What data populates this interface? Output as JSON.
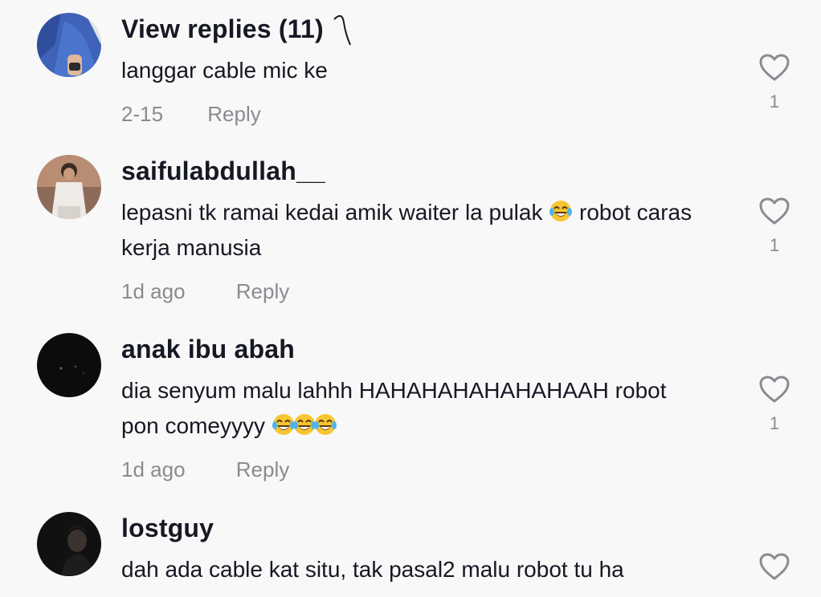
{
  "comments": [
    {
      "username": "View replies (11)",
      "text": "langgar cable mic ke",
      "date": "2-15",
      "reply": "Reply",
      "likes": "1",
      "avatar_icon": "person-blue-shirt-icon"
    },
    {
      "username": "saifulabdullah__",
      "text_part1": "lepasni tk ramai kedai amik waiter la pulak",
      "text_part2": "robot caras kerja manusia",
      "date": "1d ago",
      "reply": "Reply",
      "likes": "1",
      "avatar_icon": "person-white-shirt-icon"
    },
    {
      "username": "anak ibu abah",
      "text_part1": "dia senyum malu lahhh HAHAHAHAHAHAHAAH robot pon comeyyyy",
      "date": "1d ago",
      "reply": "Reply",
      "likes": "1",
      "avatar_icon": "dark-night-avatar-icon"
    },
    {
      "username": "lostguy",
      "text": "dah ada cable kat situ, tak pasal2 malu robot tu ha",
      "avatar_icon": "dark-face-avatar-icon"
    }
  ],
  "colors": {
    "background": "#f8f8f8",
    "primary_text": "#161823",
    "secondary_text": "#8a8b91",
    "emoji_face": "#f7c532",
    "emoji_tear": "#4fb4ea"
  },
  "icons": {
    "like": "heart-outline-icon",
    "laugh": "face-with-tears-of-joy-emoji"
  }
}
